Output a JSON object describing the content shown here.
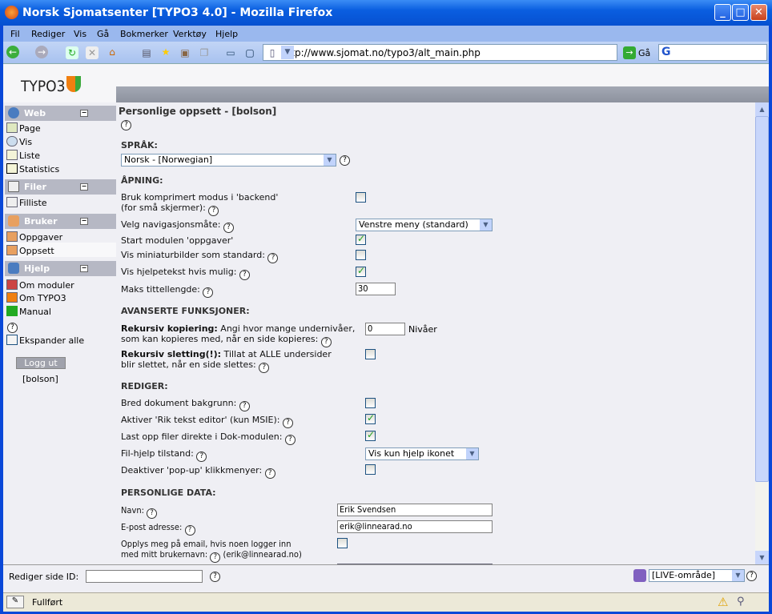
{
  "window": {
    "title": "Norsk Sjomatsenter [TYPO3 4.0] - Mozilla Firefox"
  },
  "menu": [
    "Fil",
    "Rediger",
    "Vis",
    "Gå",
    "Bokmerker",
    "Verktøy",
    "Hjelp"
  ],
  "toolbar": {
    "url": "http://www.sjomat.no/typo3/alt_main.php",
    "go_label": "Gå"
  },
  "logo": "TYPO3",
  "nav": {
    "groups": [
      {
        "label": "Web",
        "items": [
          "Page",
          "Vis",
          "Liste",
          "Statistics"
        ]
      },
      {
        "label": "Filer",
        "items": [
          "Filliste"
        ]
      },
      {
        "label": "Bruker",
        "items": [
          "Oppgaver",
          "Oppsett"
        ]
      },
      {
        "label": "Hjelp",
        "items": [
          "Om moduler",
          "Om TYPO3",
          "Manual"
        ]
      }
    ],
    "expand_all": "Ekspander alle",
    "logout": "Logg ut",
    "username": "[bolson]",
    "active_item": "Oppsett"
  },
  "form": {
    "title": "Personlige oppsett - [bolson]",
    "sections": {
      "language": "SPRÅK:",
      "opening": "ÅPNING:",
      "advanced": "AVANSERTE FUNKSJONER:",
      "edit": "REDIGER:",
      "personal": "PERSONLIGE DATA:"
    },
    "language_value": "Norsk - [Norwegian]",
    "compressed_label_1": "Bruk komprimert modus i 'backend'",
    "compressed_label_2": "(for små skjermer):",
    "compressed_checked": false,
    "nav_mode_label": "Velg navigasjonsmåte:",
    "nav_mode_value": "Venstre meny (standard)",
    "start_tasks_label": "Start modulen 'oppgaver'",
    "start_tasks_checked": true,
    "thumbnails_label": "Vis miniaturbilder som standard:",
    "thumbnails_checked": false,
    "helptext_label": "Vis hjelpetekst hvis mulig:",
    "helptext_checked": true,
    "max_title_label": "Maks tittellengde:",
    "max_title_value": "30",
    "rec_copy_bold": "Rekursiv kopiering:",
    "rec_copy_1": " Angi hvor mange undernivåer,",
    "rec_copy_2": "som kan kopieres med, når en side kopieres:",
    "rec_copy_value": "0",
    "rec_copy_unit": "Nivåer",
    "rec_del_bold": "Rekursiv sletting(!):",
    "rec_del_1": " Tillat at ALLE undersider",
    "rec_del_2": "blir slettet, når en side slettes:",
    "rec_del_checked": false,
    "wide_doc_label": "Bred dokument bakgrunn:",
    "wide_doc_checked": false,
    "rte_label": "Aktiver 'Rik tekst editor' (kun MSIE):",
    "rte_checked": true,
    "upload_label": "Last opp filer direkte i Dok-modulen:",
    "upload_checked": true,
    "filehelp_label": "Fil-hjelp tilstand:",
    "filehelp_value": "Vis kun hjelp ikonet",
    "popup_label": "Deaktiver 'pop-up' klikkmenyer:",
    "popup_checked": false,
    "name_label": "Navn:",
    "name_value": "Erik Svendsen",
    "email_label": "E-post adresse:",
    "email_value": "erik@linnearad.no",
    "notify_1": "Opplys meg på email, hvis noen logger inn",
    "notify_2": "med mitt brukernavn:",
    "notify_email": "(erik@linnearad.no)",
    "notify_checked": false
  },
  "bottom": {
    "edit_page_label": "Rediger side ID:",
    "edit_page_value": "",
    "workspace": "[LIVE-område]"
  },
  "status": {
    "text": "Fullført"
  },
  "help_glyph": "?"
}
